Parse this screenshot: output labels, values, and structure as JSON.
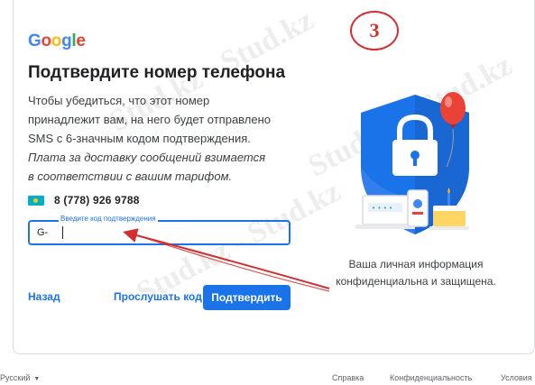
{
  "logo": {
    "letters": [
      {
        "char": "G",
        "color": "#4285F4"
      },
      {
        "char": "o",
        "color": "#EA4335"
      },
      {
        "char": "o",
        "color": "#FBBC05"
      },
      {
        "char": "g",
        "color": "#4285F4"
      },
      {
        "char": "l",
        "color": "#34A853"
      },
      {
        "char": "e",
        "color": "#EA4335"
      }
    ]
  },
  "title": "Подтвердите номер телефона",
  "description": {
    "normal": "Чтобы убедиться, что этот номер принадлежит вам, на него будет отправлено SMS с 6-значным кодом подтверждения.",
    "italic": "Плата за доставку сообщений взимается в соответствии с вашим тарифом."
  },
  "phone": {
    "flag": "kz-flag-icon",
    "number": "8 (778) 926 9788"
  },
  "code_field": {
    "label": "Введите код подтверждения",
    "prefix": "G-",
    "value": ""
  },
  "actions": {
    "back": "Назад",
    "listen": "Прослушать код",
    "confirm": "Подтвердить"
  },
  "privacy_text": "Ваша личная информация конфиденциальна и защищена.",
  "step_badge": "3",
  "footer": {
    "language": "Русский",
    "help": "Справка",
    "privacy": "Конфиденциальность",
    "terms": "Условия"
  },
  "watermark": "Stud.kz - Stud.kz",
  "colors": {
    "accent": "#1a73e8",
    "shield": "#1a73e8",
    "balloon": "#ea4335",
    "annotation": "#d32f2f"
  }
}
